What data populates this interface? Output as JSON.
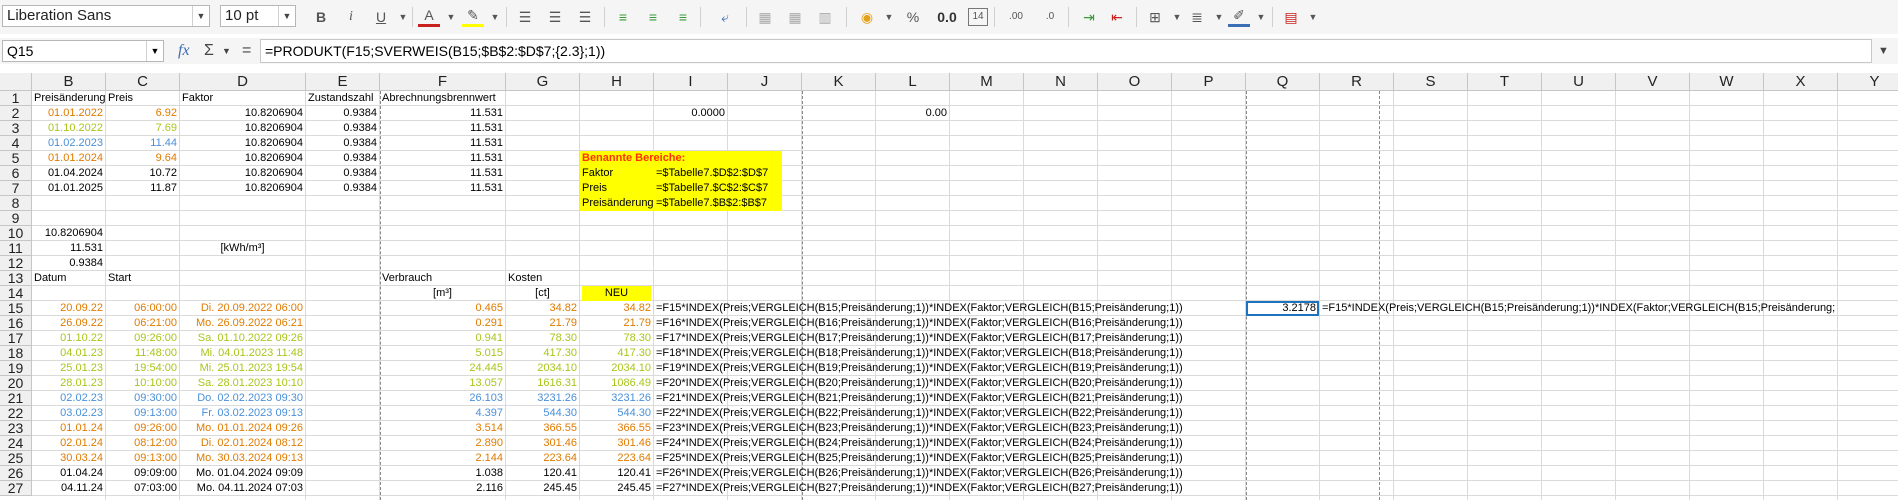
{
  "toolbar": {
    "font_name": "Liberation Sans",
    "font_size": "10 pt",
    "number_format": "0.0",
    "day_badge": "14",
    "icons": [
      "bold-icon",
      "italic-icon",
      "underline-icon",
      "font-color-icon",
      "highlight-icon",
      "align-left-icon",
      "align-center-icon",
      "align-right-icon",
      "wrap-icon",
      "merge-icon",
      "currency-icon",
      "percent-icon",
      "number-format-icon",
      "date-icon",
      "add-decimal-icon",
      "remove-decimal-icon",
      "indent-icon",
      "outdent-icon",
      "borders-icon",
      "border-style-icon",
      "border-color-icon",
      "conditional-icon"
    ]
  },
  "formula_bar": {
    "cell_ref": "Q15",
    "fx": "fx",
    "sigma": "Σ",
    "equals": "=",
    "formula": "=PRODUKT(F15;SVERWEIS(B15;$B$2:$D$7;{2.3};1))"
  },
  "columns": [
    "B",
    "C",
    "D",
    "E",
    "F",
    "G",
    "H",
    "I",
    "J",
    "K",
    "L",
    "M",
    "N",
    "O",
    "P",
    "Q",
    "R",
    "S",
    "T",
    "U",
    "V",
    "W",
    "X",
    "Y"
  ],
  "rows": [
    "1",
    "2",
    "3",
    "4",
    "5",
    "6",
    "7",
    "8",
    "9",
    "10",
    "11",
    "12",
    "13",
    "14",
    "15",
    "16",
    "17",
    "18",
    "19",
    "20",
    "21",
    "22",
    "23",
    "24",
    "25",
    "26",
    "27"
  ],
  "header_row": {
    "B": "Preisänderung",
    "C": "Preis",
    "D": "Faktor",
    "E": "Zustandszahl",
    "F": "Abrechnungsbrennwert"
  },
  "price_table": [
    {
      "date": "01.01.2022",
      "price": "6.92",
      "factor": "10.8206904",
      "z": "0.9384",
      "brenn": "11.531",
      "tone": "y1"
    },
    {
      "date": "01.10.2022",
      "price": "7.69",
      "factor": "10.8206904",
      "z": "0.9384",
      "brenn": "11.531",
      "tone": "y2"
    },
    {
      "date": "01.02.2023",
      "price": "11.44",
      "factor": "10.8206904",
      "z": "0.9384",
      "brenn": "11.531",
      "tone": "y3"
    },
    {
      "date": "01.01.2024",
      "price": "9.64",
      "factor": "10.8206904",
      "z": "0.9384",
      "brenn": "11.531",
      "tone": "y1"
    },
    {
      "date": "01.04.2024",
      "price": "10.72",
      "factor": "10.8206904",
      "z": "0.9384",
      "brenn": "11.531",
      "tone": ""
    },
    {
      "date": "01.01.2025",
      "price": "11.87",
      "factor": "10.8206904",
      "z": "0.9384",
      "brenn": "11.531",
      "tone": ""
    }
  ],
  "row2_extra": {
    "I": "0.0000",
    "L": "0.00"
  },
  "named_ranges": {
    "title": "Benannte Bereiche:",
    "items": [
      {
        "name": "Faktor",
        "ref": "=$Tabelle7.$D$2:$D$7"
      },
      {
        "name": "Preis",
        "ref": "=$Tabelle7.$C$2:$C$7"
      },
      {
        "name": "Preisänderung",
        "ref": "=$Tabelle7.$B$2:$B$7"
      }
    ]
  },
  "row10_b": "10.8206904",
  "row11_b": "11.531",
  "row11_d": "[kWh/m³]",
  "row12_b": "0.9384",
  "row13": {
    "B": "Datum",
    "C": "Start",
    "F": "Verbrauch",
    "G": "Kosten"
  },
  "row14": {
    "F": "[m³]",
    "G": "[ct]",
    "H": "NEU"
  },
  "q15_value": "3.2178",
  "q15_formula": "=F15*INDEX(Preis;VERGLEICH(B15;Preisänderung;1))*INDEX(Faktor;VERGLEICH(B15;Preisänderung;",
  "data_rows": [
    {
      "b": "20.09.22",
      "c": "06:00:00",
      "d": "Di. 20.09.2022 06:00",
      "f": "0.465",
      "g": "34.82",
      "h": "34.82",
      "i": "=F15*INDEX(Preis;VERGLEICH(B15;Preisänderung;1))*INDEX(Faktor;VERGLEICH(B15;Preisänderung;1))",
      "tone": "y1"
    },
    {
      "b": "26.09.22",
      "c": "06:21:00",
      "d": "Mo. 26.09.2022 06:21",
      "f": "0.291",
      "g": "21.79",
      "h": "21.79",
      "i": "=F16*INDEX(Preis;VERGLEICH(B16;Preisänderung;1))*INDEX(Faktor;VERGLEICH(B16;Preisänderung;1))",
      "tone": "y1"
    },
    {
      "b": "01.10.22",
      "c": "09:26:00",
      "d": "Sa. 01.10.2022 09:26",
      "f": "0.941",
      "g": "78.30",
      "h": "78.30",
      "i": "=F17*INDEX(Preis;VERGLEICH(B17;Preisänderung;1))*INDEX(Faktor;VERGLEICH(B17;Preisänderung;1))",
      "tone": "y2"
    },
    {
      "b": "04.01.23",
      "c": "11:48:00",
      "d": "Mi. 04.01.2023 11:48",
      "f": "5.015",
      "g": "417.30",
      "h": "417.30",
      "i": "=F18*INDEX(Preis;VERGLEICH(B18;Preisänderung;1))*INDEX(Faktor;VERGLEICH(B18;Preisänderung;1))",
      "tone": "y2"
    },
    {
      "b": "25.01.23",
      "c": "19:54:00",
      "d": "Mi. 25.01.2023 19:54",
      "f": "24.445",
      "g": "2034.10",
      "h": "2034.10",
      "i": "=F19*INDEX(Preis;VERGLEICH(B19;Preisänderung;1))*INDEX(Faktor;VERGLEICH(B19;Preisänderung;1))",
      "tone": "y2"
    },
    {
      "b": "28.01.23",
      "c": "10:10:00",
      "d": "Sa. 28.01.2023 10:10",
      "f": "13.057",
      "g": "1616.31",
      "h": "1086.49",
      "i": "=F20*INDEX(Preis;VERGLEICH(B20;Preisänderung;1))*INDEX(Faktor;VERGLEICH(B20;Preisänderung;1))",
      "tone": "y2"
    },
    {
      "b": "02.02.23",
      "c": "09:30:00",
      "d": "Do. 02.02.2023 09:30",
      "f": "26.103",
      "g": "3231.26",
      "h": "3231.26",
      "i": "=F21*INDEX(Preis;VERGLEICH(B21;Preisänderung;1))*INDEX(Faktor;VERGLEICH(B21;Preisänderung;1))",
      "tone": "y3"
    },
    {
      "b": "03.02.23",
      "c": "09:13:00",
      "d": "Fr. 03.02.2023 09:13",
      "f": "4.397",
      "g": "544.30",
      "h": "544.30",
      "i": "=F22*INDEX(Preis;VERGLEICH(B22;Preisänderung;1))*INDEX(Faktor;VERGLEICH(B22;Preisänderung;1))",
      "tone": "y3"
    },
    {
      "b": "01.01.24",
      "c": "09:26:00",
      "d": "Mo. 01.01.2024 09:26",
      "f": "3.514",
      "g": "366.55",
      "h": "366.55",
      "i": "=F23*INDEX(Preis;VERGLEICH(B23;Preisänderung;1))*INDEX(Faktor;VERGLEICH(B23;Preisänderung;1))",
      "tone": "y1"
    },
    {
      "b": "02.01.24",
      "c": "08:12:00",
      "d": "Di. 02.01.2024 08:12",
      "f": "2.890",
      "g": "301.46",
      "h": "301.46",
      "i": "=F24*INDEX(Preis;VERGLEICH(B24;Preisänderung;1))*INDEX(Faktor;VERGLEICH(B24;Preisänderung;1))",
      "tone": "y1"
    },
    {
      "b": "30.03.24",
      "c": "09:13:00",
      "d": "Mo. 30.03.2024 09:13",
      "f": "2.144",
      "g": "223.64",
      "h": "223.64",
      "i": "=F25*INDEX(Preis;VERGLEICH(B25;Preisänderung;1))*INDEX(Faktor;VERGLEICH(B25;Preisänderung;1))",
      "tone": "y1"
    },
    {
      "b": "01.04.24",
      "c": "09:09:00",
      "d": "Mo. 01.04.2024 09:09",
      "f": "1.038",
      "g": "120.41",
      "h": "120.41",
      "i": "=F26*INDEX(Preis;VERGLEICH(B26;Preisänderung;1))*INDEX(Faktor;VERGLEICH(B26;Preisänderung;1))",
      "tone": ""
    },
    {
      "b": "04.11.24",
      "c": "07:03:00",
      "d": "Mo. 04.11.2024 07:03",
      "f": "2.116",
      "g": "245.45",
      "h": "245.45",
      "i": "=F27*INDEX(Preis;VERGLEICH(B27;Preisänderung;1))*INDEX(Faktor;VERGLEICH(B27;Preisänderung;1))",
      "tone": ""
    }
  ]
}
